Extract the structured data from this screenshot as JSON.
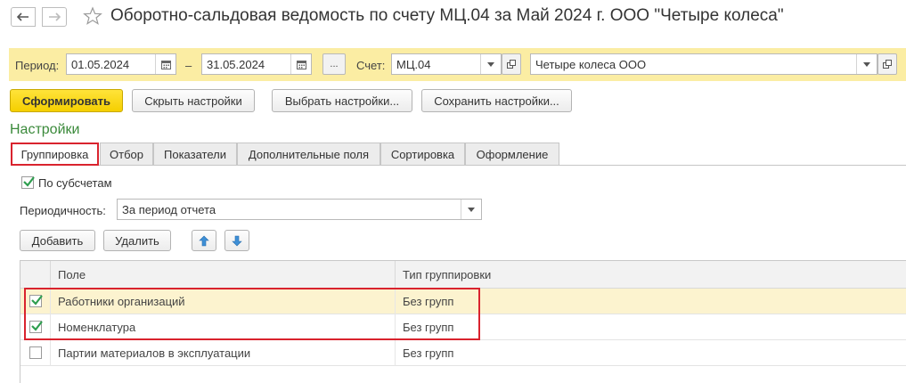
{
  "window": {
    "title": "Оборотно-сальдовая ведомость по счету МЦ.04 за Май 2024 г. ООО \"Четыре колеса\""
  },
  "period": {
    "label": "Период:",
    "from": "01.05.2024",
    "dash": "–",
    "to": "31.05.2024",
    "dots_label": "...",
    "account_label": "Счет:",
    "account": "МЦ.04",
    "organization": "Четыре колеса ООО"
  },
  "toolbar": {
    "generate_label": "Сформировать",
    "hide_settings_label": "Скрыть настройки",
    "choose_settings_label": "Выбрать настройки...",
    "save_settings_label": "Сохранить настройки..."
  },
  "settings": {
    "title": "Настройки",
    "tabs": [
      {
        "label": "Группировка",
        "active": true
      },
      {
        "label": "Отбор"
      },
      {
        "label": "Показатели"
      },
      {
        "label": "Дополнительные поля"
      },
      {
        "label": "Сортировка"
      },
      {
        "label": "Оформление"
      }
    ],
    "by_subaccounts_label": "По субсчетам",
    "by_subaccounts_checked": true,
    "periodicity_label": "Периодичность:",
    "periodicity_value": "За период отчета",
    "add_label": "Добавить",
    "delete_label": "Удалить"
  },
  "grouping_table": {
    "columns": [
      "Поле",
      "Тип группировки"
    ],
    "rows": [
      {
        "checked": true,
        "field": "Работники организаций",
        "type": "Без групп",
        "selected": true
      },
      {
        "checked": true,
        "field": "Номенклатура",
        "type": "Без групп",
        "selected": false
      },
      {
        "checked": false,
        "field": "Партии материалов в эксплуатации",
        "type": "Без групп",
        "selected": false
      }
    ]
  },
  "colors": {
    "accent_yellow": "#ffe33a",
    "period_bar": "#fbeda3",
    "highlight_red": "#d9232e",
    "settings_green": "#3b8a3b",
    "check_green": "#2e9e4f"
  }
}
